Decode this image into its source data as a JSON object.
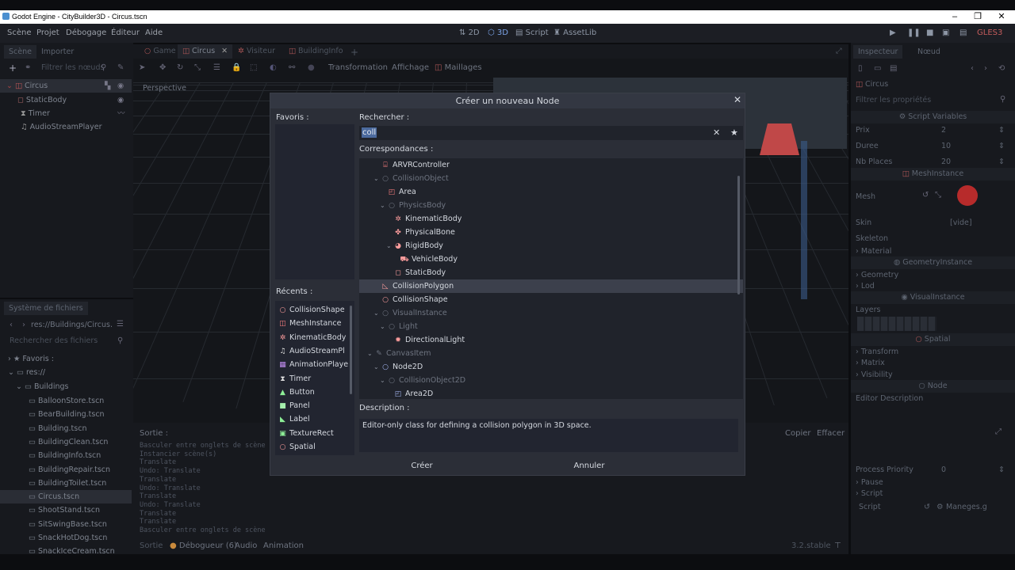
{
  "window": {
    "title": "Godot Engine - CityBuilder3D - Circus.tscn"
  },
  "menu": [
    "Scène",
    "Projet",
    "Débogage",
    "Éditeur",
    "Aide"
  ],
  "top_buttons": {
    "b2d": "2D",
    "b3d": "3D",
    "script": "Script",
    "assetlib": "AssetLib",
    "renderer": "GLES3"
  },
  "scene_dock": {
    "tabs": [
      "Scène",
      "Importer"
    ],
    "filter_placeholder": "Filtrer les nœuds",
    "nodes": [
      "Circus",
      "StaticBody",
      "Timer",
      "AudioStreamPlayer"
    ]
  },
  "fs_dock": {
    "title": "Système de fichiers",
    "path": "res://Buildings/Circus.",
    "search_placeholder": "Rechercher des fichiers",
    "favorites": "Favoris :",
    "root": "res://",
    "folder": "Buildings",
    "files": [
      "BalloonStore.tscn",
      "BearBuilding.tscn",
      "Building.tscn",
      "BuildingClean.tscn",
      "BuildingInfo.tscn",
      "BuildingRepair.tscn",
      "BuildingToilet.tscn",
      "Circus.tscn",
      "ShootStand.tscn",
      "SitSwingBase.tscn",
      "SnackHotDog.tscn",
      "SnackIceCream.tscn"
    ]
  },
  "viewport": {
    "tabs": [
      "Game",
      "Circus",
      "Visiteur",
      "BuildingInfo"
    ],
    "toolbar": [
      "Transformation",
      "Affichage",
      "Maillages"
    ],
    "perspective": "Perspective"
  },
  "output": {
    "label": "Sortie :",
    "copy": "Copier",
    "clear": "Effacer",
    "lines": [
      "Basculer entre onglets de scène",
      "Instancier scène(s)",
      "Translate",
      "Undo: Translate",
      "Translate",
      "Undo: Translate",
      "Translate",
      "Undo: Translate",
      "Translate",
      "Translate",
      "Basculer entre onglets de scène"
    ]
  },
  "bottom_bar": {
    "items": [
      "Sortie",
      "Débogueur (6)",
      "Audio",
      "Animation"
    ],
    "version": "3.2.stable"
  },
  "inspector": {
    "tabs": [
      "Inspecteur",
      "Nœud"
    ],
    "node": "Circus",
    "filter_placeholder": "Filtrer les propriétés",
    "script_variables": "Script Variables",
    "props": [
      {
        "name": "Prix",
        "value": "2"
      },
      {
        "name": "Duree",
        "value": "10"
      },
      {
        "name": "Nb Places",
        "value": "20"
      }
    ],
    "meshinstance": "MeshInstance",
    "mesh": "Mesh",
    "skin": "Skin",
    "skin_value": "[vide]",
    "skeleton": "Skeleton",
    "material": "Material",
    "geometryinstance": "GeometryInstance",
    "geometry": "Geometry",
    "lod": "Lod",
    "visualinstance": "VisualInstance",
    "layers": "Layers",
    "spatial": "Spatial",
    "transform": "Transform",
    "matrix": "Matrix",
    "visibility": "Visibility",
    "node_section": "Node",
    "editor_description": "Editor Description",
    "process_priority": "Process Priority",
    "process_priority_value": "0",
    "pause": "Pause",
    "script_section": "Script",
    "script_label": "Script",
    "script_value": "Maneges.g"
  },
  "dialog": {
    "title": "Créer un nouveau Node",
    "favorites_label": "Favoris :",
    "search_label": "Rechercher :",
    "search_value": "coll",
    "matches_label": "Correspondances :",
    "recent_label": "Récents :",
    "recent": [
      {
        "label": "CollisionShape",
        "icon": "○",
        "color": "#fc9c9c"
      },
      {
        "label": "MeshInstance",
        "icon": "◫",
        "color": "#fc7f7f"
      },
      {
        "label": "KinematicBody",
        "icon": "✲",
        "color": "#fc9c9c"
      },
      {
        "label": "AudioStreamPl",
        "icon": "♫",
        "color": "#e0e0e0"
      },
      {
        "label": "AnimationPlaye",
        "icon": "▦",
        "color": "#c38ef1"
      },
      {
        "label": "Timer",
        "icon": "⧗",
        "color": "#e0e0e0"
      },
      {
        "label": "Button",
        "icon": "▲",
        "color": "#8eef97"
      },
      {
        "label": "Panel",
        "icon": "■",
        "color": "#a5efac"
      },
      {
        "label": "Label",
        "icon": "◣",
        "color": "#8eef97"
      },
      {
        "label": "TextureRect",
        "icon": "▣",
        "color": "#8eef97"
      },
      {
        "label": "Spatial",
        "icon": "○",
        "color": "#fc9c9c"
      }
    ],
    "matches": [
      {
        "label": "ARVRController",
        "indent": 1,
        "icon": "⌸",
        "color": "#fc7f7f",
        "dim": false,
        "arrow": ""
      },
      {
        "label": "CollisionObject",
        "indent": 1,
        "icon": "○",
        "color": "#e0e0e0",
        "dim": true,
        "arrow": "⌄"
      },
      {
        "label": "Area",
        "indent": 2,
        "icon": "◰",
        "color": "#fc7f7f",
        "dim": false,
        "arrow": ""
      },
      {
        "label": "PhysicsBody",
        "indent": 2,
        "icon": "○",
        "color": "#e0e0e0",
        "dim": true,
        "arrow": "⌄"
      },
      {
        "label": "KinematicBody",
        "indent": 3,
        "icon": "✲",
        "color": "#fc9c9c",
        "dim": false,
        "arrow": ""
      },
      {
        "label": "PhysicalBone",
        "indent": 3,
        "icon": "✤",
        "color": "#fc9c9c",
        "dim": false,
        "arrow": ""
      },
      {
        "label": "RigidBody",
        "indent": 3,
        "icon": "◕",
        "color": "#fc9c9c",
        "dim": false,
        "arrow": "⌄"
      },
      {
        "label": "VehicleBody",
        "indent": 4,
        "icon": "⛟",
        "color": "#fc9c9c",
        "dim": false,
        "arrow": ""
      },
      {
        "label": "StaticBody",
        "indent": 3,
        "icon": "◻",
        "color": "#fc9c9c",
        "dim": false,
        "arrow": ""
      },
      {
        "label": "CollisionPolygon",
        "indent": 1,
        "icon": "◺",
        "color": "#fc9c9c",
        "dim": false,
        "arrow": "",
        "selected": true
      },
      {
        "label": "CollisionShape",
        "indent": 1,
        "icon": "○",
        "color": "#fc9c9c",
        "dim": false,
        "arrow": ""
      },
      {
        "label": "VisualInstance",
        "indent": 1,
        "icon": "○",
        "color": "#e0e0e0",
        "dim": true,
        "arrow": "⌄"
      },
      {
        "label": "Light",
        "indent": 2,
        "icon": "○",
        "color": "#e0e0e0",
        "dim": true,
        "arrow": "⌄"
      },
      {
        "label": "DirectionalLight",
        "indent": 3,
        "icon": "✹",
        "color": "#fc9c9c",
        "dim": false,
        "arrow": ""
      },
      {
        "label": "CanvasItem",
        "indent": 0,
        "icon": "✎",
        "color": "#e0e0e0",
        "dim": true,
        "arrow": "⌄"
      },
      {
        "label": "Node2D",
        "indent": 1,
        "icon": "○",
        "color": "#a5b7f3",
        "dim": false,
        "arrow": "⌄"
      },
      {
        "label": "CollisionObject2D",
        "indent": 2,
        "icon": "○",
        "color": "#e0e0e0",
        "dim": true,
        "arrow": "⌄"
      },
      {
        "label": "Area2D",
        "indent": 3,
        "icon": "◰",
        "color": "#a5b7f3",
        "dim": false,
        "arrow": ""
      }
    ],
    "description_label": "Description :",
    "description": "Editor-only class for defining a collision polygon in 3D space.",
    "create": "Créer",
    "cancel": "Annuler"
  }
}
